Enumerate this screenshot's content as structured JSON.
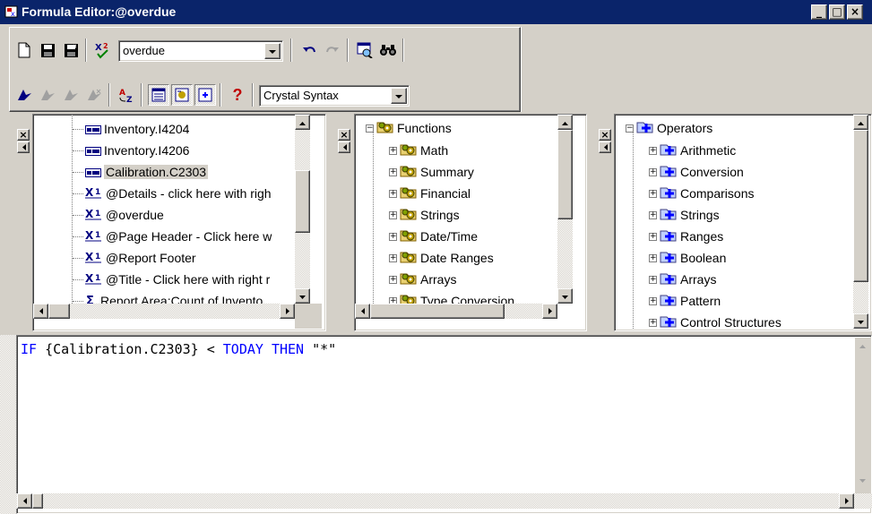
{
  "window": {
    "title": "Formula Editor:@overdue",
    "minimize": "_",
    "maximize": "□",
    "close": "×"
  },
  "toolbar": {
    "formula_combo_value": "overdue",
    "syntax_combo_value": "Crystal Syntax",
    "help_label": "?"
  },
  "fields_tree": {
    "items": [
      {
        "label": "Inventory.I4204",
        "icon": "field-icon"
      },
      {
        "label": "Inventory.I4206",
        "icon": "field-icon"
      },
      {
        "label": "Calibration.C2303",
        "icon": "field-icon",
        "selected": true
      },
      {
        "label": "@Details - click here with righ",
        "icon": "formula-icon"
      },
      {
        "label": "@overdue",
        "icon": "formula-icon"
      },
      {
        "label": "@Page Header - Click here w",
        "icon": "formula-icon"
      },
      {
        "label": "@Report Footer",
        "icon": "formula-icon"
      },
      {
        "label": "@Title - Click here with right r",
        "icon": "formula-icon"
      },
      {
        "label": "Report Area:Count of Invento",
        "icon": "summary-icon"
      }
    ]
  },
  "functions_tree": {
    "root": "Functions",
    "items": [
      "Math",
      "Summary",
      "Financial",
      "Strings",
      "Date/Time",
      "Date Ranges",
      "Arrays",
      "Type Conversion"
    ]
  },
  "operators_tree": {
    "root": "Operators",
    "items": [
      "Arithmetic",
      "Conversion",
      "Comparisons",
      "Strings",
      "Ranges",
      "Boolean",
      "Arrays",
      "Pattern",
      "Control Structures"
    ]
  },
  "editor": {
    "tokens": [
      {
        "t": "IF",
        "kw": true
      },
      {
        "t": " {Calibration.C2303} < ",
        "kw": false
      },
      {
        "t": "TODAY",
        "kw": true
      },
      {
        "t": " ",
        "kw": false
      },
      {
        "t": "THEN",
        "kw": true
      },
      {
        "t": " \"*\"",
        "kw": false
      }
    ]
  },
  "colors": {
    "titlebar": "#0a246a",
    "keyword": "#0000ff",
    "face": "#d4d0c8"
  }
}
